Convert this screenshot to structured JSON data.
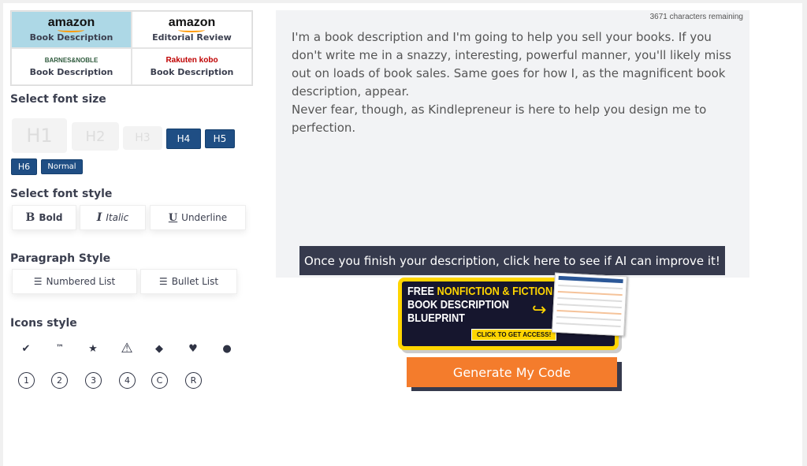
{
  "platforms": [
    {
      "logo": "amazon",
      "label": "Book Description",
      "selected": true
    },
    {
      "logo": "amazon",
      "label": "Editorial Review",
      "selected": false
    },
    {
      "logo": "BARNES&NOBLE",
      "label": "Book Description",
      "selected": false
    },
    {
      "logo": "Rakuten kobo",
      "label": "Book Description",
      "selected": false
    }
  ],
  "font_size": {
    "heading": "Select font size",
    "buttons": [
      "H1",
      "H2",
      "H3",
      "H4",
      "H5",
      "H6",
      "Normal"
    ]
  },
  "font_style": {
    "heading": "Select font style",
    "bold": "Bold",
    "italic": "Italic",
    "underline": "Underline",
    "bold_glyph": "B",
    "italic_glyph": "I",
    "underline_glyph": "U"
  },
  "paragraph": {
    "heading": "Paragraph Style",
    "numbered": "Numbered List",
    "bullet": "Bullet List"
  },
  "icons": {
    "heading": "Icons style",
    "row1": [
      "✔",
      "™",
      "★",
      "⚠",
      "◆",
      "♥",
      "●"
    ],
    "row2": [
      "1",
      "2",
      "3",
      "4",
      "C",
      "R"
    ]
  },
  "editor": {
    "counter": "3671 characters remaining",
    "paragraphs": [
      "I'm a book description and I'm going to help you sell your books. If you don't write me in a snazzy, interesting, powerful manner, you'll likely miss out on loads of book sales. Same goes for how I, as the magnificent book description, appear.",
      "Never fear, though, as Kindlepreneur is here to help you design me to perfection."
    ]
  },
  "ai_button": "Once you finish your description, click here to see if AI can improve it!",
  "banner": {
    "free": "FREE ",
    "highlight": "NONFICTION & FICTION",
    "line2": "BOOK DESCRIPTION",
    "line3": "BLUEPRINT",
    "cta": "CLICK TO GET ACCESS!"
  },
  "generate_button": "Generate My Code",
  "colors": {
    "selected_platform": "#add8e6",
    "active_size": "#1f4e84",
    "generate": "#f47c2c",
    "dark": "#363a4d",
    "banner_yellow": "#ffd500"
  }
}
